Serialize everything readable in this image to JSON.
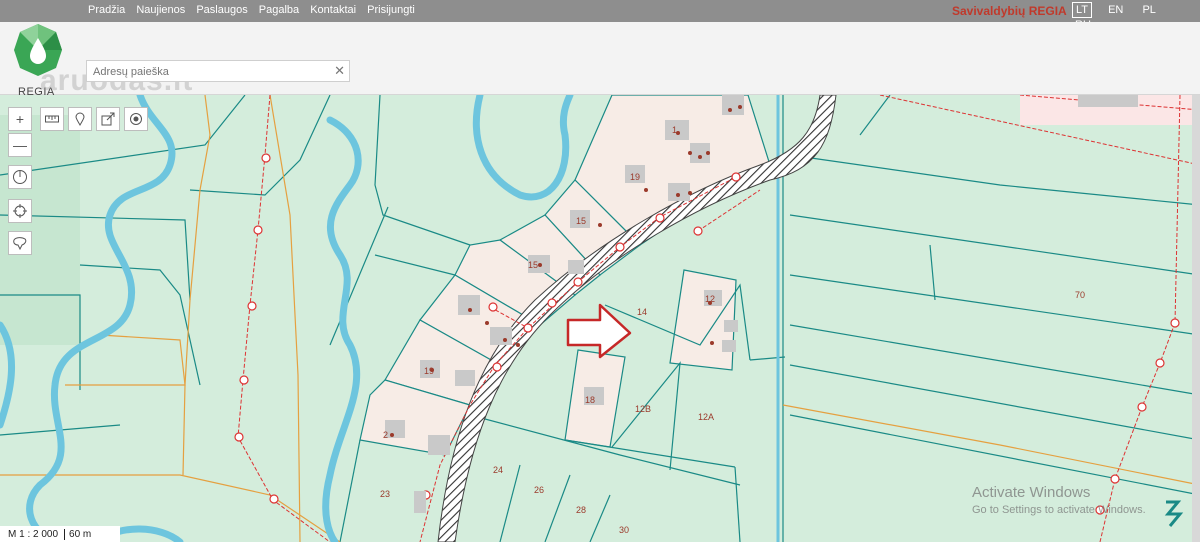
{
  "nav": {
    "items": [
      "Pradžia",
      "Naujienos",
      "Paslaugos",
      "Pagalba",
      "Kontaktai",
      "Prisijungti"
    ]
  },
  "brand": {
    "title": "Savivaldybių REGIA"
  },
  "languages": {
    "items": [
      "LT",
      "EN",
      "PL",
      "RU"
    ],
    "active": "LT"
  },
  "logo": {
    "text": "REGIA"
  },
  "search": {
    "placeholder": "Adresų paieška",
    "clear_glyph": "✕"
  },
  "watermark": {
    "text": "aruodas.lt"
  },
  "map": {
    "scale_label": "M 1 : 2 000",
    "scale_bar_label": "60 m",
    "parcel_labels": [
      "14",
      "12",
      "70",
      "18",
      "12B",
      "12A",
      "24",
      "26",
      "28",
      "30",
      "23",
      "2",
      "19",
      "15",
      "15",
      "19",
      "1"
    ],
    "colors": {
      "land": "#d4eddc",
      "lot": "#f7ece6",
      "parcel_line": "#1a8a86",
      "water": "#6dc5de",
      "red_line": "#d33",
      "orange_line": "#e5a040"
    }
  },
  "tools": {
    "zoom_in": "+",
    "zoom_out": "—"
  },
  "activate": {
    "title": "Activate Windows",
    "subtitle": "Go to Settings to activate Windows."
  }
}
